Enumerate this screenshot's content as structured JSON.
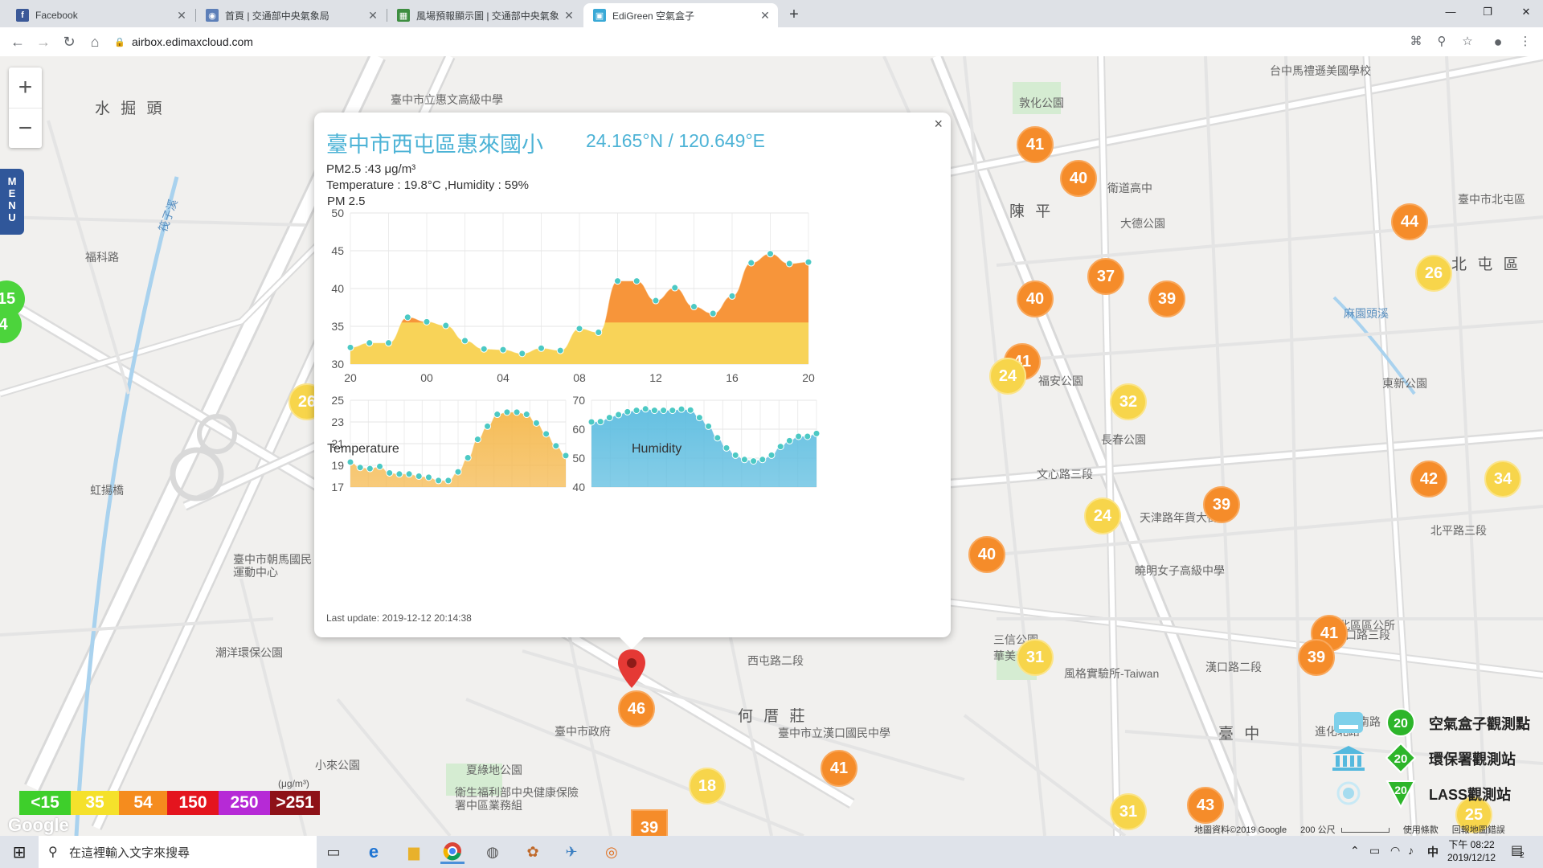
{
  "browser": {
    "tabs": [
      {
        "title": "Facebook",
        "favicon_color": "#3b5998",
        "favicon_glyph": "f"
      },
      {
        "title": "首頁 | 交通部中央氣象局",
        "favicon_color": "#5d7fb8",
        "favicon_glyph": "◉"
      },
      {
        "title": "風場預報顯示圖 | 交通部中央氣象",
        "favicon_color": "#3e8e41",
        "favicon_glyph": "▦"
      },
      {
        "title": "EdiGreen 空氣盒子",
        "favicon_color": "#3aa9d6",
        "favicon_glyph": "▣"
      }
    ],
    "url": "airbox.edimaxcloud.com"
  },
  "map": {
    "labels": [
      {
        "text": "水 掘 頭",
        "big": true
      },
      {
        "text": "陳 平",
        "big": true
      },
      {
        "text": "北 屯 區",
        "big": true
      },
      {
        "text": "何 厝 莊",
        "big": true
      },
      {
        "text": "臺 中",
        "big": true
      },
      {
        "text": "敦化公園"
      },
      {
        "text": "衛道高中"
      },
      {
        "text": "大德公園"
      },
      {
        "text": "福安公園"
      },
      {
        "text": "東新公園"
      },
      {
        "text": "長春公園"
      },
      {
        "text": "天津路年貨大街"
      },
      {
        "text": "曉明女子高級中學"
      },
      {
        "text": "北區區公所"
      },
      {
        "text": "三信公園"
      },
      {
        "text": "華美公園"
      },
      {
        "text": "風格實驗所-Taiwan"
      },
      {
        "text": "臺中市政府"
      },
      {
        "text": "夏綠地公園"
      },
      {
        "text": "小來公園"
      },
      {
        "text": "潮洋環保公園"
      },
      {
        "text": "臺中市立惠文高級中學"
      },
      {
        "text": "臺中市朝馬國民運動中心"
      },
      {
        "text": "衛生福利部中央健康保險署中區業務組"
      },
      {
        "text": "臺中市立漢口國民中學"
      },
      {
        "text": "台中馬禮遜美國學校"
      },
      {
        "text": "臺中市北屯區"
      },
      {
        "text": "麻園頭溪",
        "blue": true
      },
      {
        "text": "筏子溪",
        "blue": true
      },
      {
        "text": "福科路"
      },
      {
        "text": "虹揚橋"
      },
      {
        "text": "漢口路三段"
      },
      {
        "text": "漢口路二段"
      },
      {
        "text": "文心路三段"
      },
      {
        "text": "北平路三段"
      },
      {
        "text": "河南路"
      },
      {
        "text": "西屯路二段"
      },
      {
        "text": "進化北路"
      }
    ],
    "markers": [
      {
        "value": "41",
        "color": "orange"
      },
      {
        "value": "40",
        "color": "orange"
      },
      {
        "value": "44",
        "color": "orange"
      },
      {
        "value": "26",
        "color": "yellow"
      },
      {
        "value": "37",
        "color": "orange"
      },
      {
        "value": "39",
        "color": "orange"
      },
      {
        "value": "40",
        "color": "orange"
      },
      {
        "value": "41",
        "color": "orange"
      },
      {
        "value": "24",
        "color": "yellow"
      },
      {
        "value": "32",
        "color": "yellow"
      },
      {
        "value": "39",
        "color": "orange"
      },
      {
        "value": "24",
        "color": "yellow"
      },
      {
        "value": "40",
        "color": "orange"
      },
      {
        "value": "42",
        "color": "orange"
      },
      {
        "value": "34",
        "color": "yellow"
      },
      {
        "value": "41",
        "color": "orange"
      },
      {
        "value": "39",
        "color": "orange"
      },
      {
        "value": "31",
        "color": "yellow"
      },
      {
        "value": "46",
        "color": "orange"
      },
      {
        "value": "41",
        "color": "orange"
      },
      {
        "value": "18",
        "color": "yellow"
      },
      {
        "value": "31",
        "color": "yellow"
      },
      {
        "value": "43",
        "color": "orange"
      },
      {
        "value": "15",
        "color": "green"
      },
      {
        "value": "4",
        "color": "green"
      },
      {
        "value": "26",
        "color": "yellow"
      },
      {
        "value": "25",
        "color": "yellow"
      },
      {
        "value": "39",
        "color": "orange"
      }
    ],
    "menu_label": "MENU",
    "zoom_in": "+",
    "zoom_out": "−",
    "attribution": "地圖資料©2019 Google",
    "scale": "200 公尺",
    "terms": "使用條款",
    "report": "回報地圖錯誤",
    "google_logo": "Google"
  },
  "popup": {
    "title": "臺中市西屯區惠來國小",
    "coord": "24.165°N / 120.649°E",
    "pm25_line": "PM2.5 :43 μg/m³",
    "temp_line": "Temperature : 19.8°C ,Humidity : 59%",
    "chart_title": "PM 2.5",
    "temp_title": "Temperature",
    "hum_title": "Humidity",
    "last_update": "Last update: 2019-12-12 20:14:38",
    "close": "×"
  },
  "chart_data": [
    {
      "type": "area",
      "title": "PM 2.5",
      "x_ticks": [
        "20",
        "00",
        "04",
        "08",
        "12",
        "16",
        "20"
      ],
      "ylim": [
        30,
        50
      ],
      "y_ticks": [
        30,
        35,
        40,
        45,
        50
      ],
      "threshold": 35.5,
      "colors": {
        "low": "#f8d358",
        "high": "#f7953a",
        "point": "#4cc9c4"
      },
      "values": [
        32.2,
        32.8,
        32.8,
        36.2,
        35.6,
        35.1,
        33.1,
        32,
        31.9,
        31.4,
        32.1,
        31.8,
        34.7,
        34.2,
        41,
        41,
        38.4,
        40.1,
        37.6,
        36.7,
        39,
        43.4,
        44.6,
        43.3,
        43.5
      ]
    },
    {
      "type": "area",
      "title": "Temperature",
      "ylim": [
        17,
        25
      ],
      "y_ticks": [
        17,
        19,
        21,
        23,
        25
      ],
      "colors": {
        "fill": "#f5b94f",
        "point": "#4cc9c4"
      },
      "values": [
        19.3,
        18.8,
        18.7,
        18.9,
        18.3,
        18.2,
        18.2,
        18,
        17.9,
        17.6,
        17.6,
        18.4,
        19.7,
        21.4,
        22.6,
        23.7,
        23.9,
        23.9,
        23.7,
        22.9,
        21.9,
        20.8,
        19.9
      ]
    },
    {
      "type": "area",
      "title": "Humidity",
      "ylim": [
        40,
        70
      ],
      "y_ticks": [
        40,
        50,
        60,
        70
      ],
      "colors": {
        "fill": "#5dbde0",
        "point": "#4cc9c4"
      },
      "values": [
        62.5,
        62.6,
        64,
        65,
        66,
        66.5,
        67,
        66.5,
        66.5,
        66.5,
        66.9,
        66.6,
        64,
        61,
        57,
        53.5,
        51,
        49.5,
        49,
        49.5,
        51,
        54,
        56,
        57.5,
        57.5,
        58.5
      ]
    }
  ],
  "aqi_legend": {
    "unit": "(μg/m³)",
    "levels": [
      {
        "label": "<15",
        "color": "#3ecf2b"
      },
      {
        "label": "35",
        "color": "#f5e12b"
      },
      {
        "label": "54",
        "color": "#f58c1e"
      },
      {
        "label": "150",
        "color": "#e4141e"
      },
      {
        "label": "250",
        "color": "#b62ad6"
      },
      {
        "label": ">251",
        "color": "#8e1218"
      }
    ]
  },
  "station_legend": [
    {
      "label": "空氣盒子觀測點",
      "badge": "20"
    },
    {
      "label": "環保署觀測站",
      "badge": "20"
    },
    {
      "label": "LASS觀測站",
      "badge": "20"
    }
  ],
  "taskbar": {
    "search_placeholder": "在這裡輸入文字來搜尋",
    "time": "下午 08:22",
    "date": "2019/12/12",
    "ime": "中",
    "notif": "2"
  }
}
